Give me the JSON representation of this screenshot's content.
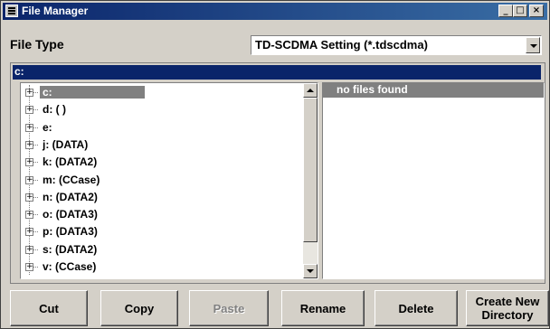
{
  "window": {
    "title": "File Manager",
    "controls": {
      "minimize": "_",
      "maximize": "□",
      "close": "×"
    }
  },
  "file_type": {
    "label": "File Type",
    "value": "TD-SCDMA Setting (*.tdscdma)"
  },
  "path": "c:",
  "tree": {
    "items": [
      {
        "label": "c:",
        "selected": true
      },
      {
        "label": "d: ( )"
      },
      {
        "label": "e:"
      },
      {
        "label": "j: (DATA)"
      },
      {
        "label": "k: (DATA2)"
      },
      {
        "label": "m: (CCase)"
      },
      {
        "label": "n: (DATA2)"
      },
      {
        "label": "o: (DATA3)"
      },
      {
        "label": "p: (DATA3)"
      },
      {
        "label": "s: (DATA2)"
      },
      {
        "label": "v: (CCase)"
      }
    ],
    "expand_glyph": "+"
  },
  "files": {
    "empty_text": "no files found"
  },
  "buttons": {
    "cut": "Cut",
    "copy": "Copy",
    "paste": "Paste",
    "rename": "Rename",
    "delete": "Delete",
    "create_line1": "Create New",
    "create_line2": "Directory"
  },
  "colors": {
    "titlebar": "#0a246a",
    "selection": "#808080",
    "face": "#d4d0c8"
  }
}
